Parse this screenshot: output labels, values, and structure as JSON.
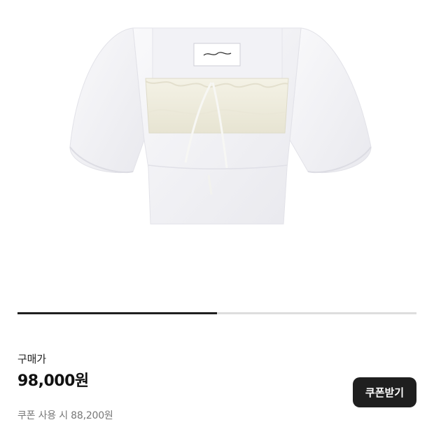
{
  "gallery": {
    "image_alt": "white square-neck puff sleeve crop blouse",
    "progress_fraction": 0.5
  },
  "price": {
    "label": "구매가",
    "value": "98,000원",
    "coupon_text": "쿠폰 사용 시 88,200원"
  },
  "coupon_button": {
    "label": "쿠폰받기"
  },
  "colors": {
    "button_bg": "#1f1f1f",
    "progress_fill": "#1f1f1f",
    "progress_track": "#dddddd"
  }
}
